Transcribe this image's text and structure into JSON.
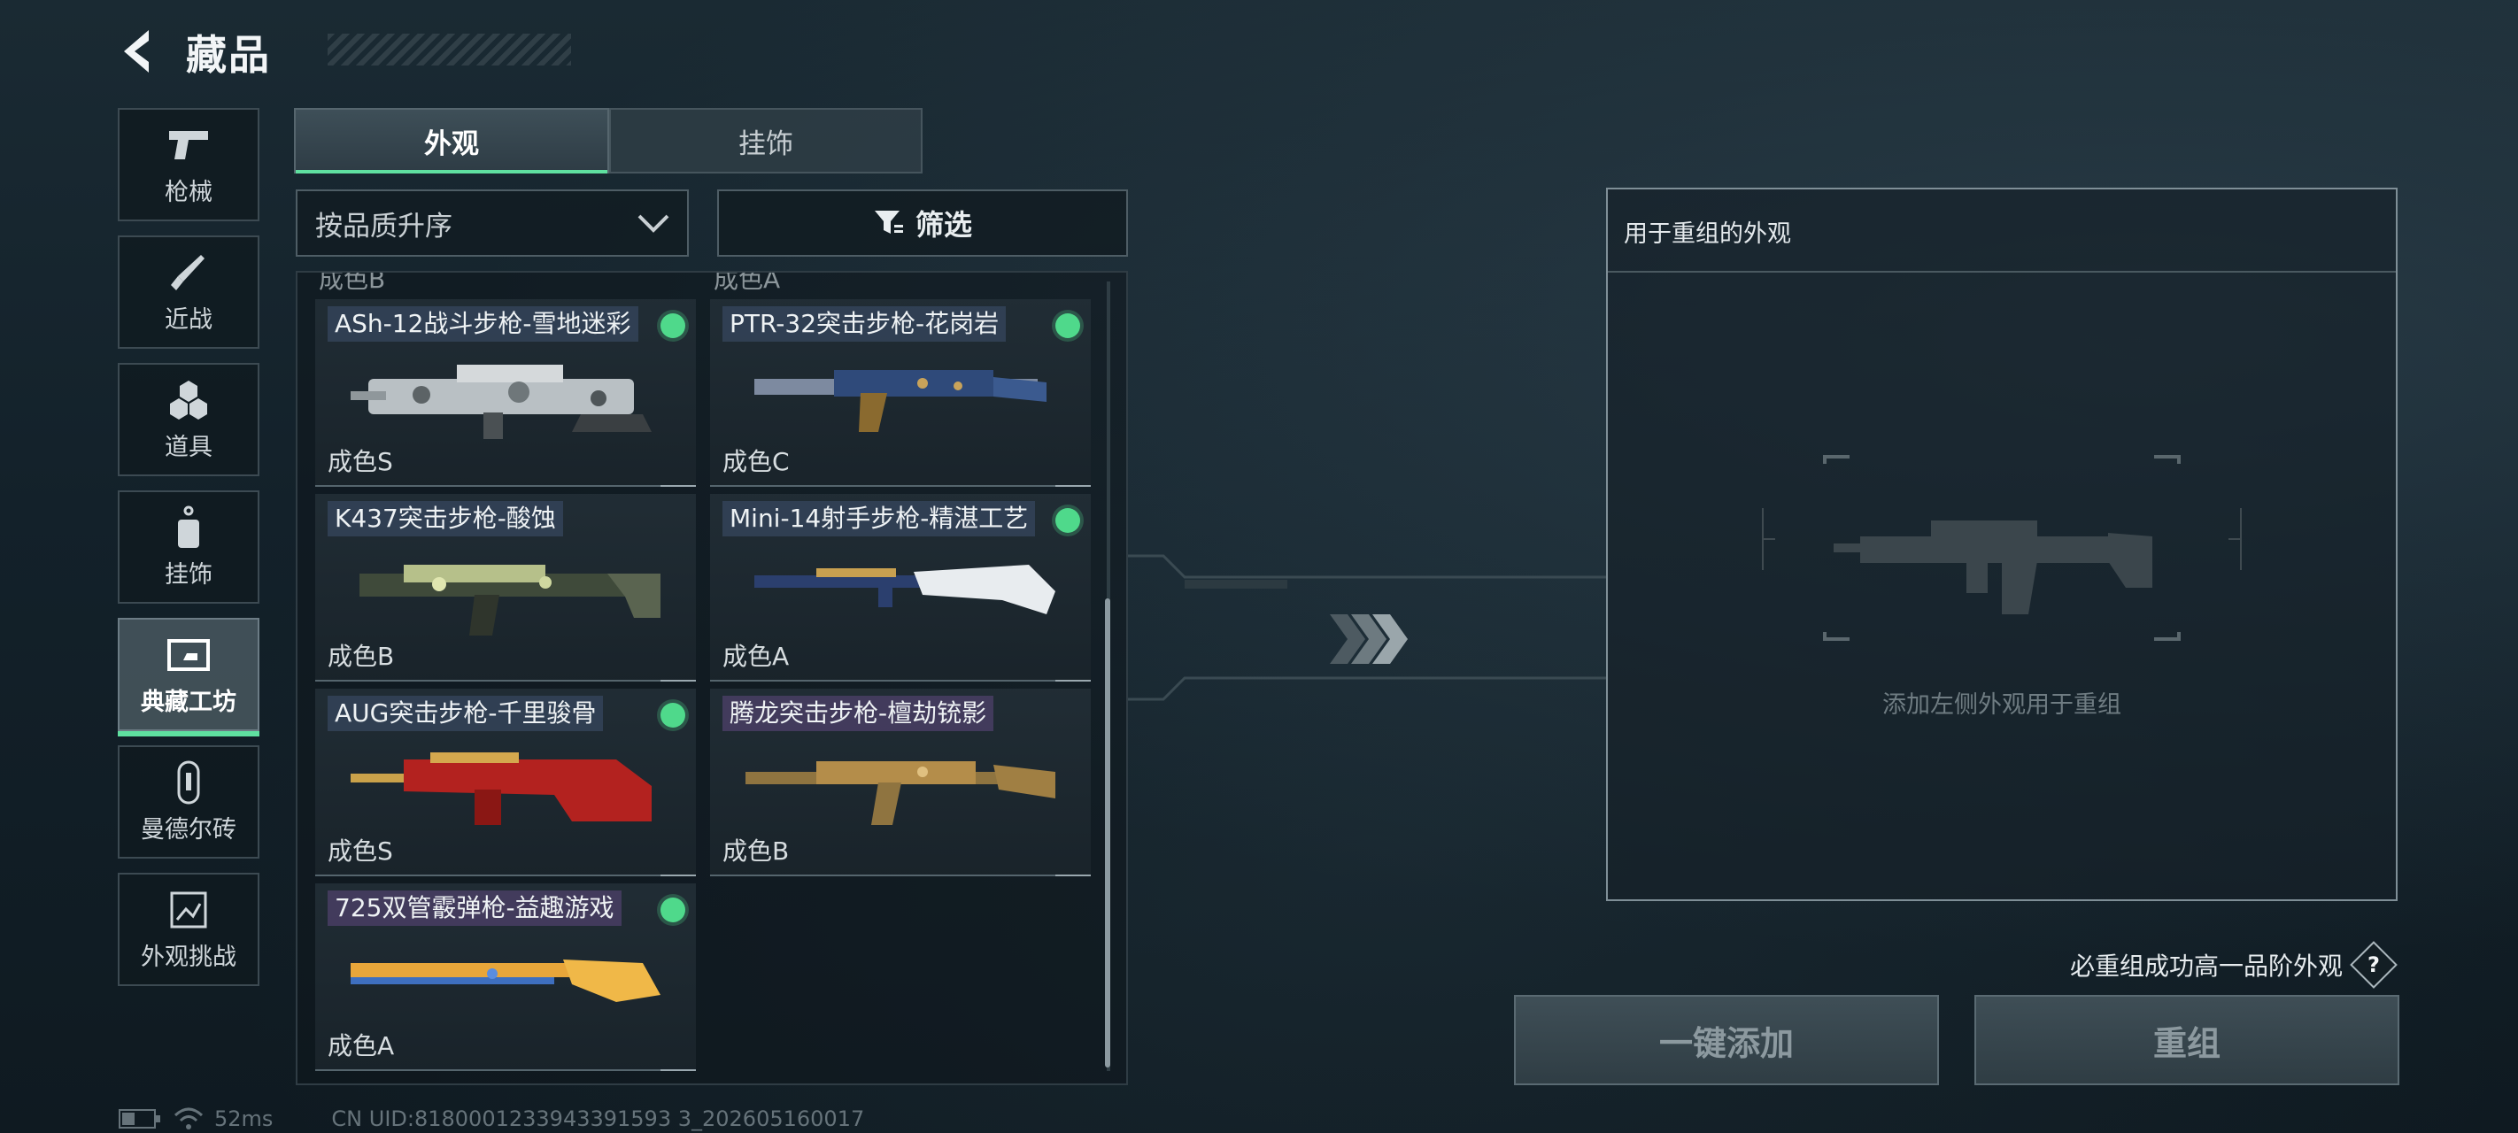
{
  "header": {
    "title": "藏品"
  },
  "nav": {
    "items": [
      {
        "label": "枪械",
        "icon": "pistol-icon"
      },
      {
        "label": "近战",
        "icon": "knife-icon"
      },
      {
        "label": "道具",
        "icon": "grenade-icon"
      },
      {
        "label": "挂饰",
        "icon": "charm-icon"
      },
      {
        "label": "典藏工坊",
        "icon": "workshop-icon",
        "active": true
      },
      {
        "label": "曼德尔砖",
        "icon": "brick-icon"
      },
      {
        "label": "外观挑战",
        "icon": "challenge-icon"
      }
    ]
  },
  "tabs": [
    {
      "label": "外观",
      "active": true
    },
    {
      "label": "挂饰",
      "active": false
    }
  ],
  "sort": {
    "value": "按品质升序"
  },
  "filter": {
    "label": "筛选"
  },
  "list": {
    "peek": [
      "成色B",
      "成色A"
    ],
    "items": [
      {
        "name": "ASh-12战斗步枪-雪地迷彩",
        "grade": "成色S",
        "owned": true
      },
      {
        "name": "PTR-32突击步枪-花岗岩",
        "grade": "成色C",
        "owned": true
      },
      {
        "name": "K437突击步枪-酸蚀",
        "grade": "成色B",
        "owned": false
      },
      {
        "name": "Mini-14射手步枪-精湛工艺",
        "grade": "成色A",
        "owned": true
      },
      {
        "name": "AUG突击步枪-千里骏骨",
        "grade": "成色S",
        "owned": true
      },
      {
        "name": "腾龙突击步枪-檀劫铳影",
        "grade": "成色B",
        "owned": false
      },
      {
        "name": "725双管霰弹枪-益趣游戏",
        "grade": "成色A",
        "owned": true
      }
    ]
  },
  "remix": {
    "title": "用于重组的外观",
    "hint": "添加左侧外观用于重组",
    "guarantee": "必重组成功高一品阶外观",
    "help": "?",
    "add_all": "一键添加",
    "remix_btn": "重组"
  },
  "status": {
    "ping": "52ms",
    "uid": "CN UID:8180001233943391593 3_202605160017"
  },
  "colors": {
    "accent": "#5fe0a0",
    "owned_dot": "#4fd98b"
  }
}
